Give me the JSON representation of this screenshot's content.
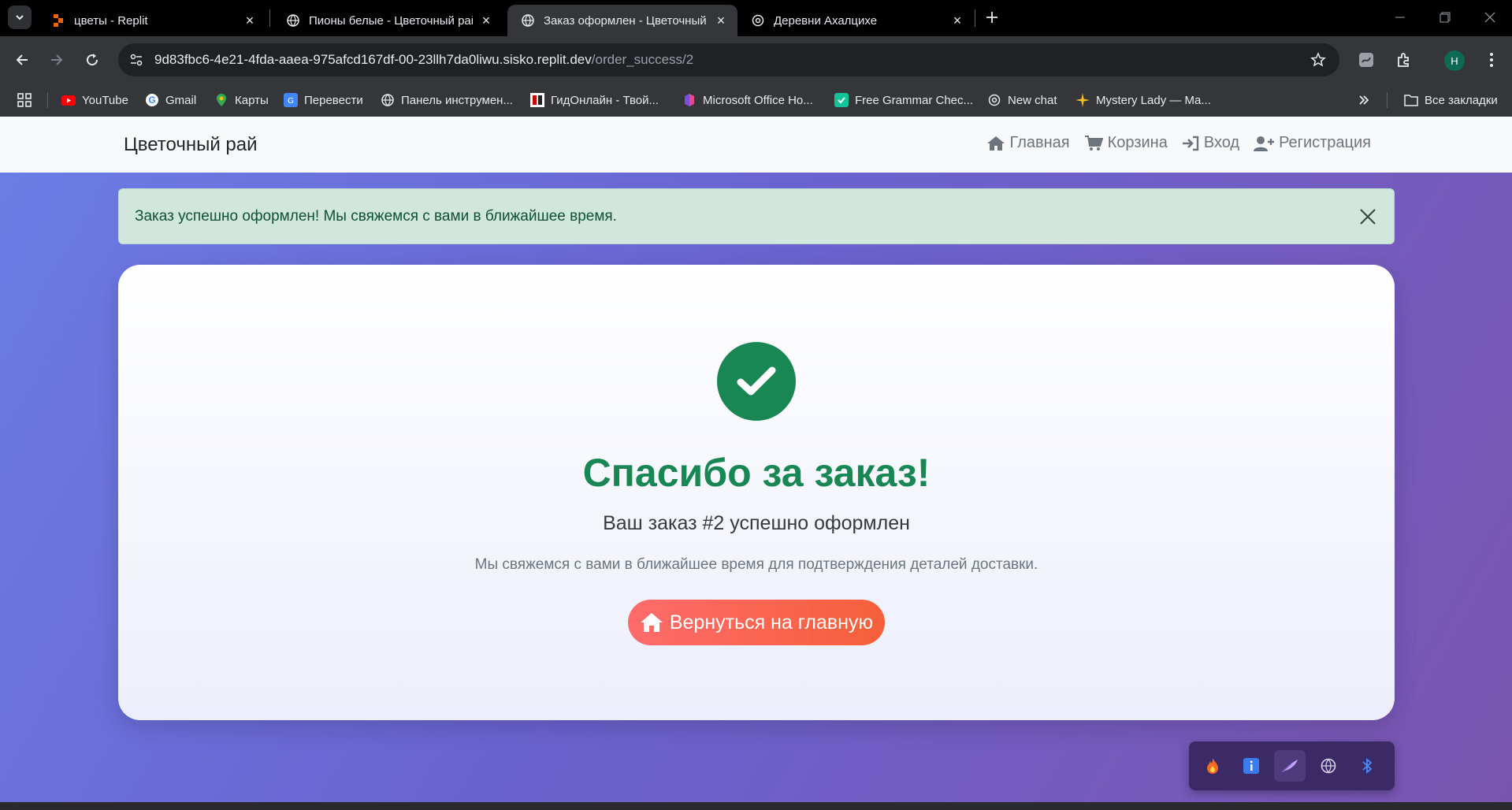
{
  "browser": {
    "tabs": [
      {
        "title": "цветы - Replit",
        "active": false,
        "favicon": "replit-icon"
      },
      {
        "title": "Пионы белые - Цветочный рай",
        "active": false,
        "favicon": "globe-icon"
      },
      {
        "title": "Заказ оформлен - Цветочный рай",
        "active": true,
        "favicon": "globe-icon"
      },
      {
        "title": "Деревни Ахалцихе",
        "active": false,
        "favicon": "openai-icon"
      }
    ],
    "url_host": "9d83fbc6-4e21-4fda-aaea-975afcd167df-00-23llh7da0liwu.sisko.replit.dev",
    "url_path": "/order_success/2",
    "profile_initial": "H",
    "bookmarks": [
      {
        "label": "YouTube",
        "icon": "youtube-icon"
      },
      {
        "label": "Gmail",
        "icon": "google-icon"
      },
      {
        "label": "Карты",
        "icon": "maps-icon"
      },
      {
        "label": "Перевести",
        "icon": "translate-icon"
      },
      {
        "label": "Панель инструмен...",
        "icon": "globe-icon"
      },
      {
        "label": "ГидОнлайн - Твой...",
        "icon": "gidonline-icon"
      },
      {
        "label": "Microsoft Office Ho...",
        "icon": "office-icon"
      },
      {
        "label": "Free Grammar Chec...",
        "icon": "grammar-icon"
      },
      {
        "label": "New chat",
        "icon": "openai-icon"
      },
      {
        "label": "Mystery Lady — Ma...",
        "icon": "sparkle-icon"
      }
    ],
    "all_bookmarks": "Все закладки"
  },
  "site": {
    "brand": "Цветочный рай",
    "nav": [
      {
        "label": "Главная",
        "icon": "home-icon"
      },
      {
        "label": "Корзина",
        "icon": "cart-icon"
      },
      {
        "label": "Вход",
        "icon": "login-icon"
      },
      {
        "label": "Регистрация",
        "icon": "user-plus-icon"
      }
    ],
    "alert": "Заказ успешно оформлен! Мы свяжемся с вами в ближайшее время.",
    "title": "Спасибо за заказ!",
    "order_line": "Ваш заказ #2 успешно оформлен",
    "note": "Мы свяжемся с вами в ближайшее время для подтверждения деталей доставки.",
    "home_button": "Вернуться на главную"
  },
  "colors": {
    "success": "#198754",
    "alert_bg": "#d1e7dd",
    "button_start": "#ff6b6b",
    "button_end": "#f5603a",
    "page_gradient_start": "#6b7de6",
    "page_gradient_end": "#7a55b0"
  }
}
